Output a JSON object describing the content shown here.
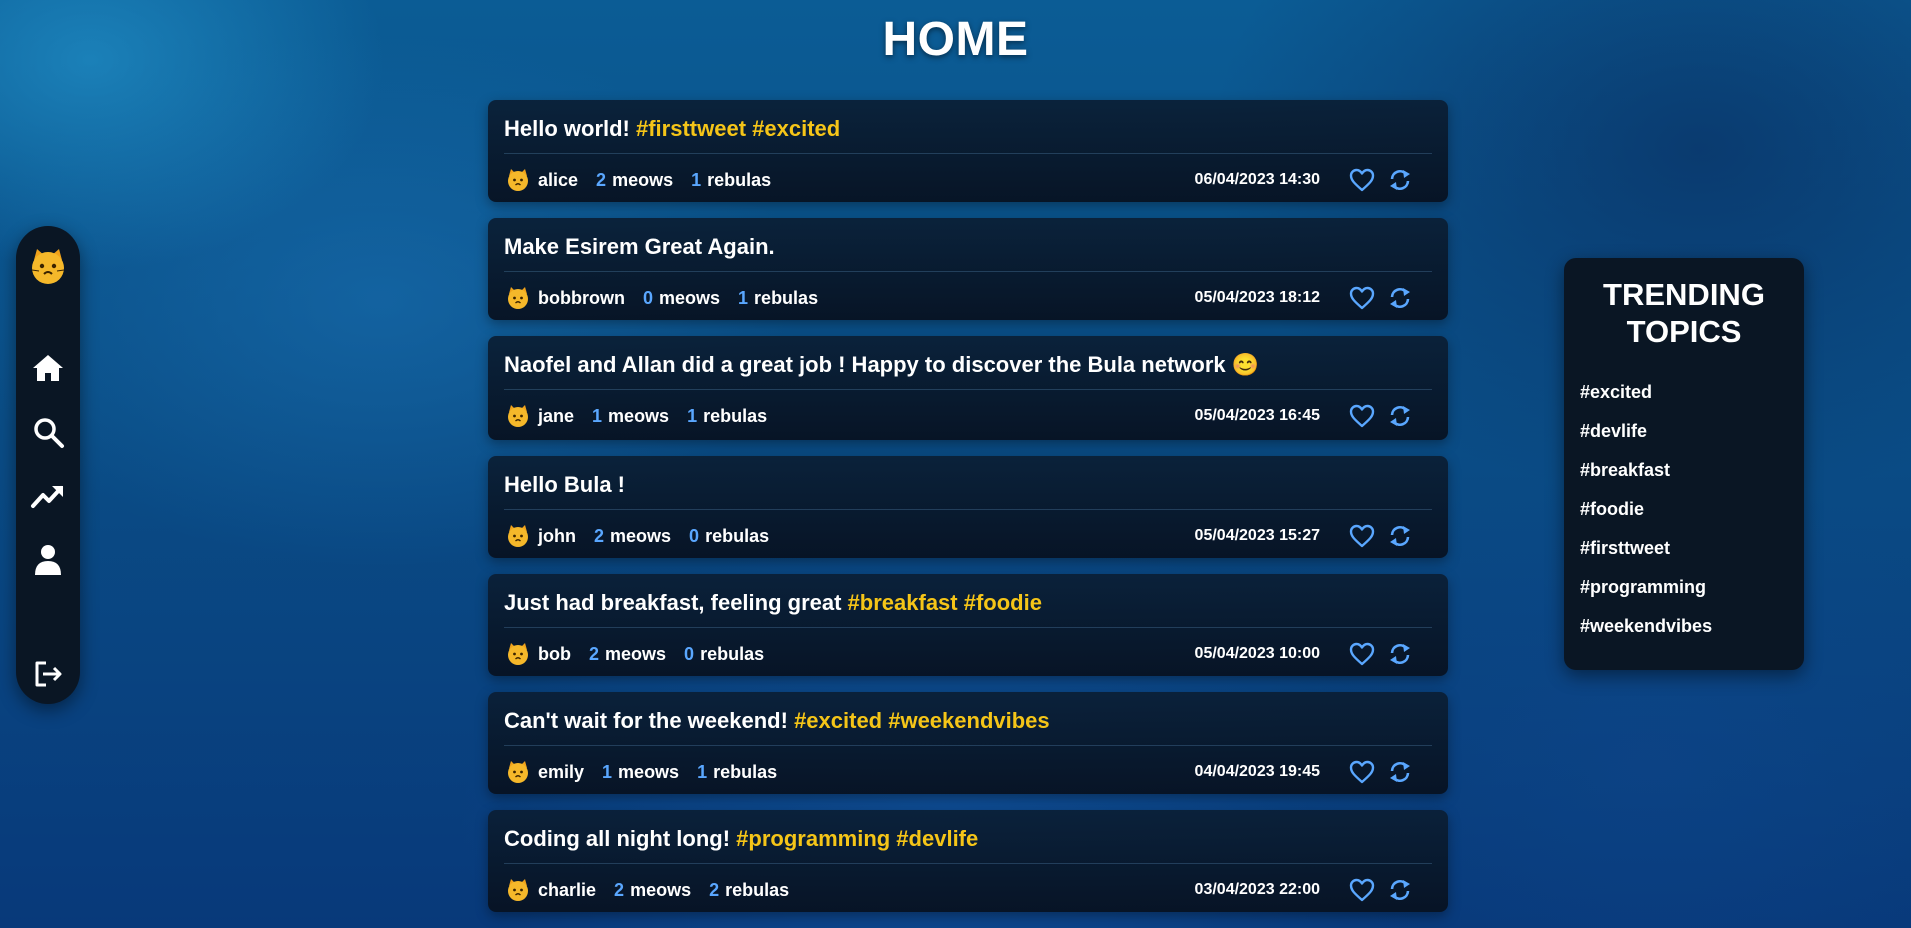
{
  "header": {
    "title": "HOME"
  },
  "sidebar": {
    "avatar_icon": "cat-face-icon",
    "items": [
      {
        "icon": "home-icon"
      },
      {
        "icon": "search-icon"
      },
      {
        "icon": "trending-icon"
      },
      {
        "icon": "user-icon"
      },
      {
        "icon": "logout-icon"
      }
    ]
  },
  "colors": {
    "hashtag": "#f5c518",
    "count": "#5aa7ff",
    "panel": "#0a1624"
  },
  "feed": {
    "tweets": [
      {
        "text": "Hello world! ",
        "tags": "#firsttweet #excited",
        "user": "alice",
        "meows": "2",
        "meows_label": "meows",
        "rebulas": "1",
        "rebulas_label": "rebulas",
        "date": "06/04/2023 14:30"
      },
      {
        "text": "Make Esirem Great Again.",
        "tags": "",
        "user": "bobbrown",
        "meows": "0",
        "meows_label": "meows",
        "rebulas": "1",
        "rebulas_label": "rebulas",
        "date": "05/04/2023 18:12"
      },
      {
        "text": "Naofel and Allan did a great job ! Happy to discover the Bula network 😊",
        "tags": "",
        "user": "jane",
        "meows": "1",
        "meows_label": "meows",
        "rebulas": "1",
        "rebulas_label": "rebulas",
        "date": "05/04/2023 16:45"
      },
      {
        "text": "Hello Bula !",
        "tags": "",
        "user": "john",
        "meows": "2",
        "meows_label": "meows",
        "rebulas": "0",
        "rebulas_label": "rebulas",
        "date": "05/04/2023 15:27"
      },
      {
        "text": "Just had breakfast, feeling great ",
        "tags": "#breakfast #foodie",
        "user": "bob",
        "meows": "2",
        "meows_label": "meows",
        "rebulas": "0",
        "rebulas_label": "rebulas",
        "date": "05/04/2023 10:00"
      },
      {
        "text": "Can't wait for the weekend! ",
        "tags": "#excited #weekendvibes",
        "user": "emily",
        "meows": "1",
        "meows_label": "meows",
        "rebulas": "1",
        "rebulas_label": "rebulas",
        "date": "04/04/2023 19:45"
      },
      {
        "text": "Coding all night long! ",
        "tags": "#programming #devlife",
        "user": "charlie",
        "meows": "2",
        "meows_label": "meows",
        "rebulas": "2",
        "rebulas_label": "rebulas",
        "date": "03/04/2023 22:00"
      }
    ]
  },
  "trending": {
    "title_line1": "TRENDING",
    "title_line2": "TOPICS",
    "topics": [
      "#excited",
      "#devlife",
      "#breakfast",
      "#foodie",
      "#firsttweet",
      "#programming",
      "#weekendvibes"
    ]
  }
}
